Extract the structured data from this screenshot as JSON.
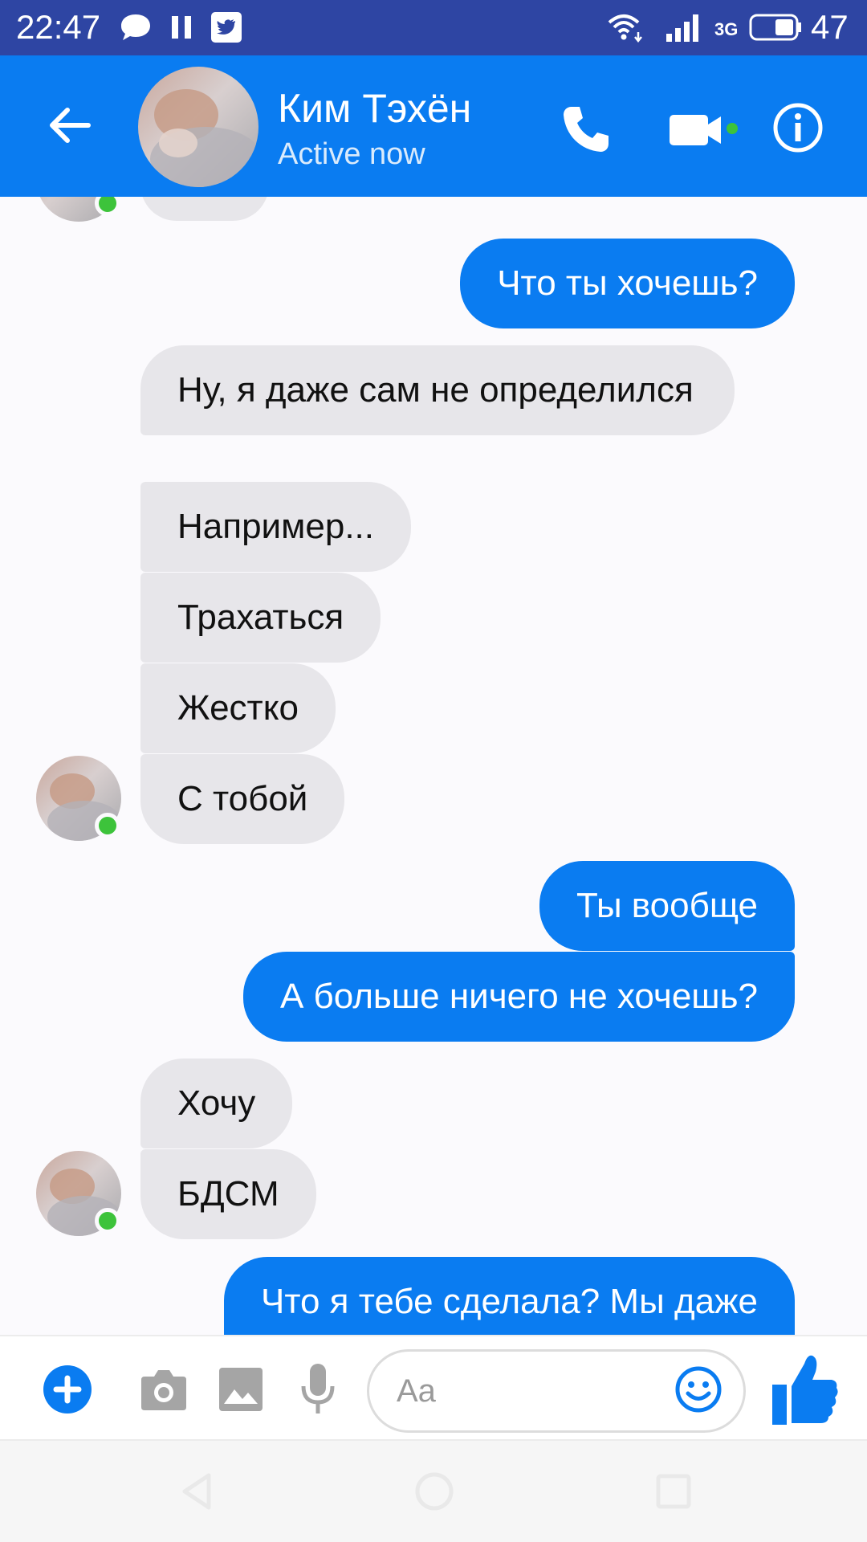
{
  "status_bar": {
    "time": "22:47",
    "network": "3G",
    "battery": "47"
  },
  "header": {
    "contact_name": "Ким Тэхён",
    "contact_status": "Active now"
  },
  "messages": [
    {
      "side": "out",
      "text": "Что ты хочешь?"
    },
    {
      "side": "in",
      "text": "Ну, я даже сам не определился"
    },
    {
      "side": "in",
      "text": "Например..."
    },
    {
      "side": "in",
      "text": "Трахаться"
    },
    {
      "side": "in",
      "text": "Жестко"
    },
    {
      "side": "in",
      "text": "С тобой"
    },
    {
      "side": "out",
      "text": "Ты вообще"
    },
    {
      "side": "out",
      "text": "А больше ничего не хочешь?"
    },
    {
      "side": "in",
      "text": "Хочу"
    },
    {
      "side": "in",
      "text": "БДСМ"
    },
    {
      "side": "out",
      "text": "Что я тебе сделала? Мы даже"
    }
  ],
  "composer": {
    "placeholder": "Aa"
  },
  "colors": {
    "status_bar": "#2e45a3",
    "accent": "#0a7cf1",
    "incoming_bubble": "#e7e6ea",
    "online": "#3dc33b"
  },
  "icons": {
    "back": "arrow-left-icon",
    "call": "phone-icon",
    "video": "video-camera-icon",
    "info": "info-icon",
    "add": "plus-circle-icon",
    "camera": "camera-icon",
    "gallery": "image-icon",
    "voice": "microphone-icon",
    "emoji": "smiley-icon",
    "like": "thumbs-up-icon"
  }
}
